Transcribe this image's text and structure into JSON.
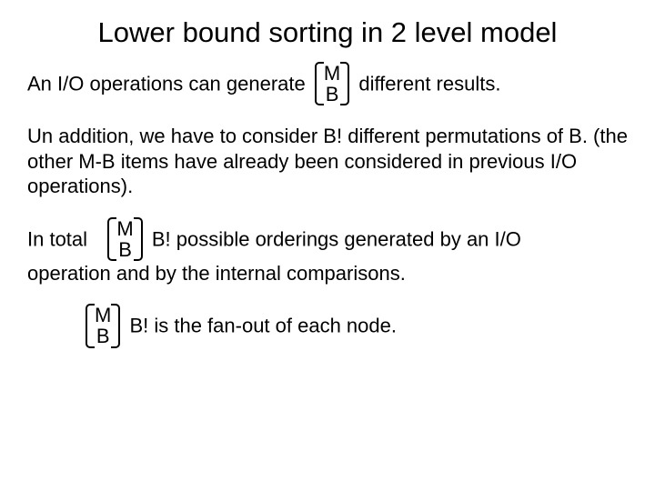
{
  "slide": {
    "title": "Lower bound sorting in 2 level model",
    "p1_a": "An I/O operations can generate",
    "p1_b": "different results.",
    "p2": "Un addition, we have to consider B! different permutations of B. (the other M-B items have already been considered in previous I/O operations).",
    "p3_a": "In total",
    "p3_b": "B! possible orderings generated by an I/O",
    "p3_c": "operation and by the internal comparisons.",
    "p4": "B! is the fan-out of each node.",
    "binom_top": "M",
    "binom_bot": "B"
  }
}
